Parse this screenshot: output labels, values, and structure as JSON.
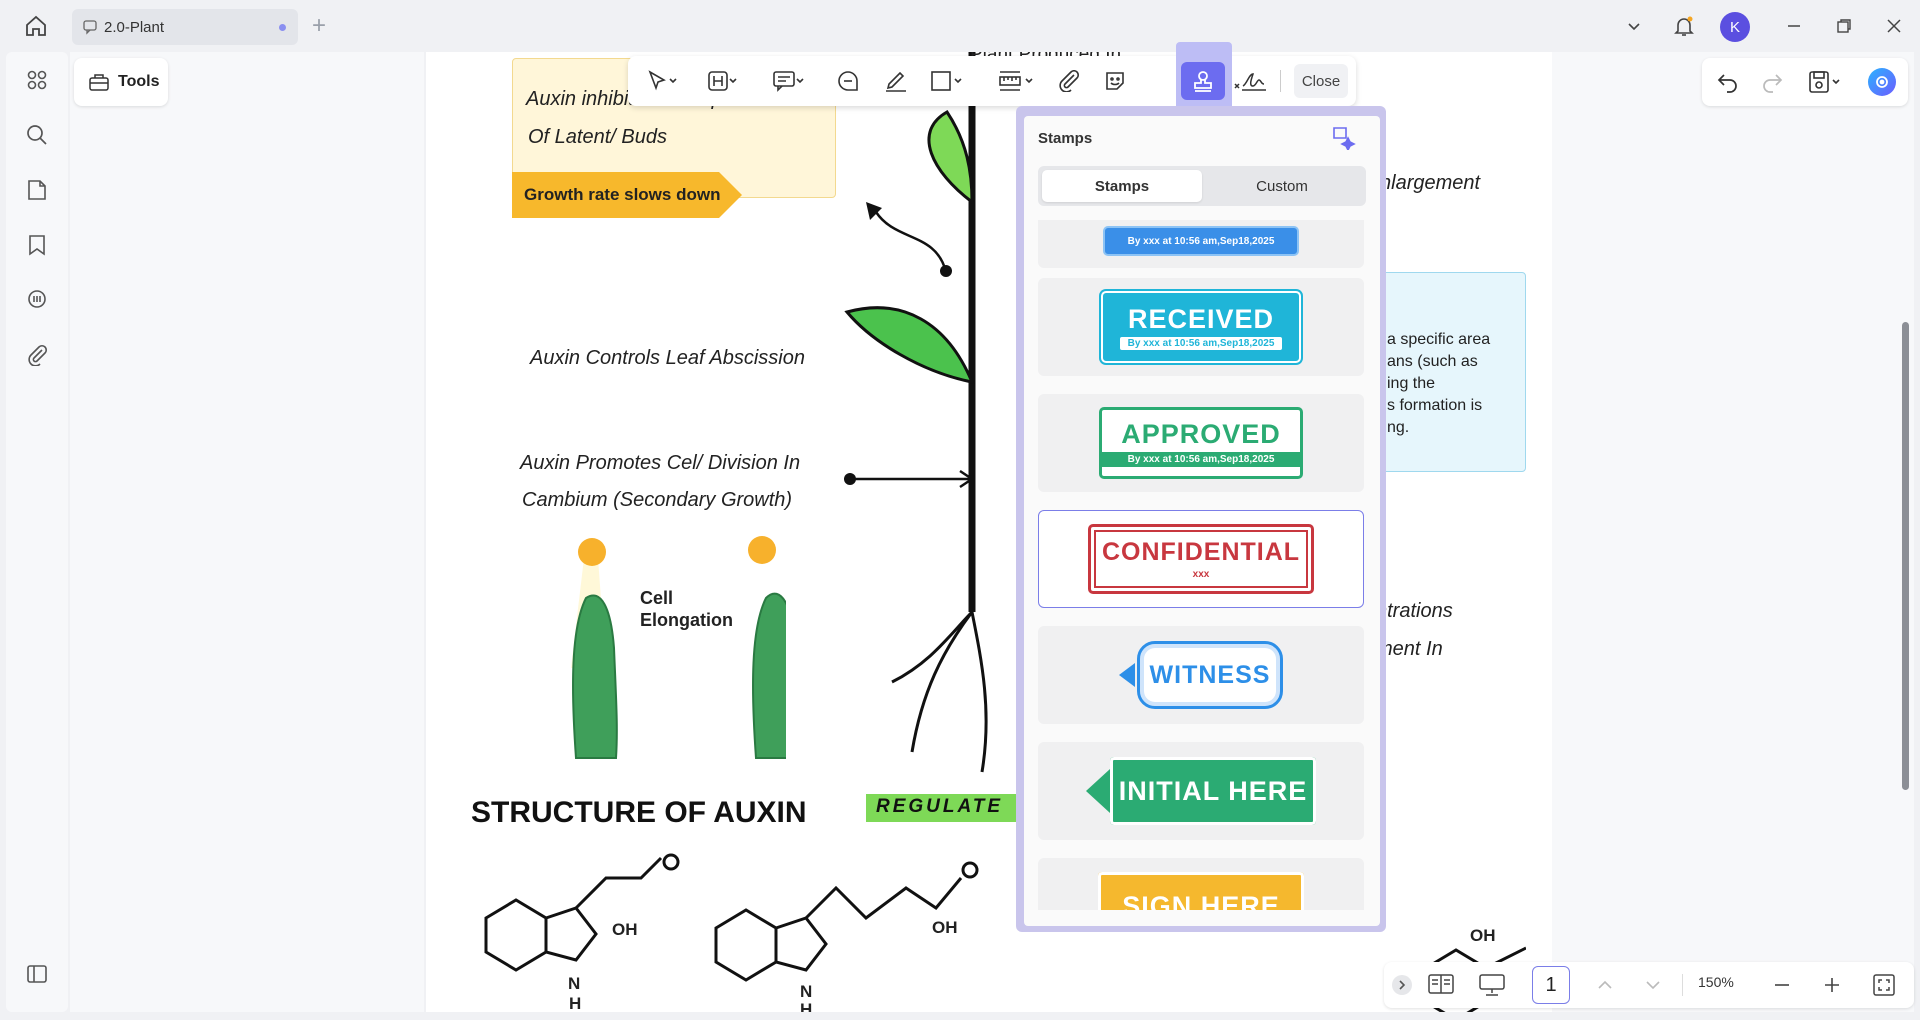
{
  "topbar": {
    "tab_title": "2.0-Plant",
    "avatar_letter": "K"
  },
  "left": {
    "tools_label": "Tools"
  },
  "toolbar": {
    "close_label": "Close"
  },
  "stamps_panel": {
    "title": "Stamps",
    "tabs": [
      "Stamps",
      "Custom"
    ],
    "items": [
      {
        "main": "",
        "sub": "By xxx at 10:56 am,Sep18,2025",
        "color": "#3a8fe8"
      },
      {
        "main": "RECEIVED",
        "sub": "By xxx at 10:56 am,Sep18,2025",
        "color": "#1fb5d8"
      },
      {
        "main": "APPROVED",
        "sub": "By xxx at 10:56 am,Sep18,2025",
        "color": "#2bab73"
      },
      {
        "main": "CONFIDENTIAL",
        "sub": "xxx",
        "color": "#c8373f"
      },
      {
        "main": "WITNESS",
        "sub": "",
        "color": "#2d8fe8"
      },
      {
        "main": "INITIAL HERE",
        "sub": "",
        "color": "#2bab73"
      },
      {
        "main": "SIGN HERE",
        "sub": "",
        "color": "#f5b82e"
      }
    ]
  },
  "document": {
    "note1_line1": "Auxin inhibits Development",
    "note1_line2": "Of Latent/ Buds",
    "banner": "Growth rate slows down",
    "leaf_abscission": "Auxin Controls Leaf Abscission",
    "cell_division_1": "Auxin Promotes Cel/ Division In",
    "cell_division_2": "Cambium (Secondary Growth)",
    "cell_elongation_1": "Cell",
    "cell_elongation_2": "Elongation",
    "top_partial": "Plant Produced In",
    "enlargement": "nlargement",
    "box_line1": "a specific area",
    "box_line2": "ans (such as",
    "box_line3": "ing the",
    "box_line4": "s formation is",
    "box_line5": "ng.",
    "concentrations": "ntrations",
    "ment_in": "ment In",
    "structure_title": "STRUCTURE OF AUXIN",
    "regulate": "REGULATE",
    "oh": "OH",
    "n": "N",
    "h": "H"
  },
  "bottombar": {
    "page": "1",
    "zoom": "150%"
  }
}
